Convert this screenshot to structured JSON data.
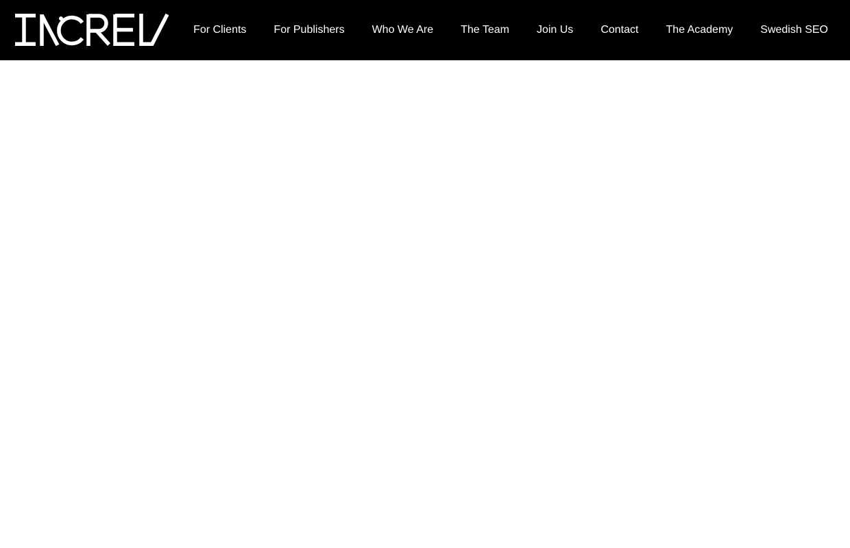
{
  "brand": {
    "logo_text": "INCREV",
    "logo_color": "#ffffff",
    "header_bg": "#000000"
  },
  "nav": {
    "items": [
      {
        "label": "For Clients"
      },
      {
        "label": "For Publishers"
      },
      {
        "label": "Who We Are"
      },
      {
        "label": "The Team"
      },
      {
        "label": "Join Us"
      },
      {
        "label": "Contact"
      },
      {
        "label": "The Academy"
      },
      {
        "label": "Swedish SEO"
      }
    ]
  }
}
